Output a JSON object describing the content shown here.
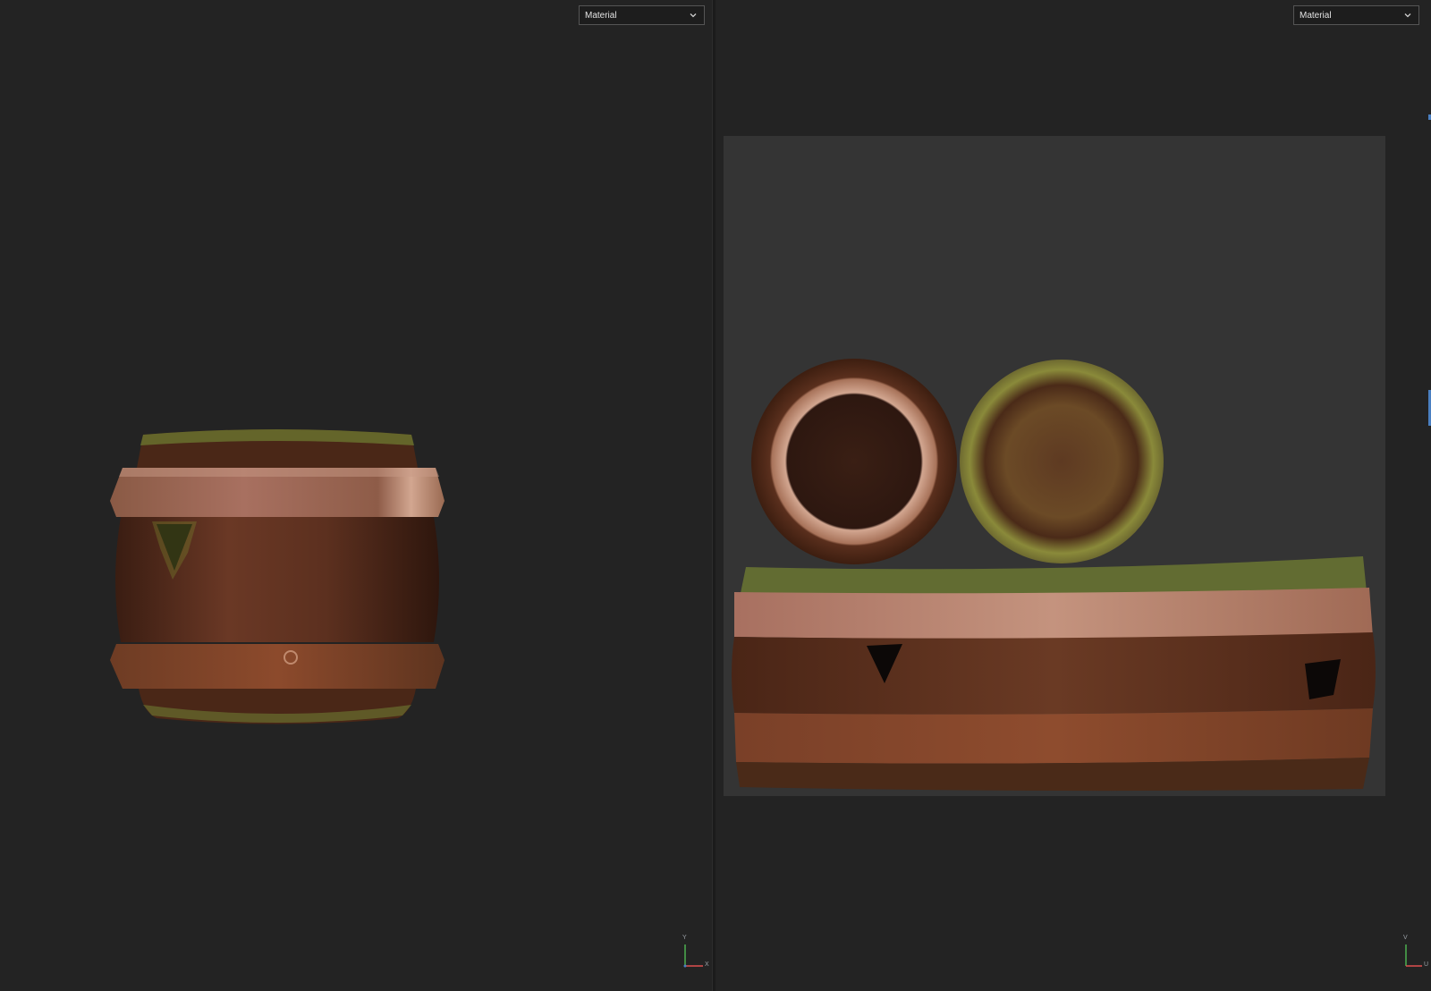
{
  "viewport_3d": {
    "channel_select": {
      "value": "Material"
    },
    "gizmo": {
      "axis_v": "Y",
      "axis_h": "X"
    }
  },
  "viewport_2d": {
    "channel_select": {
      "value": "Material"
    },
    "gizmo": {
      "axis_v": "V",
      "axis_h": "U"
    }
  },
  "colors": {
    "background": "#232323",
    "uv_tile": "#343434",
    "wood": "#5a2f1d",
    "metal_band": "#b9785b",
    "moss": "#7a8a2e",
    "axis_y": "#4caf50",
    "axis_x": "#e05050",
    "selection_edge": "#4a7fc1"
  }
}
